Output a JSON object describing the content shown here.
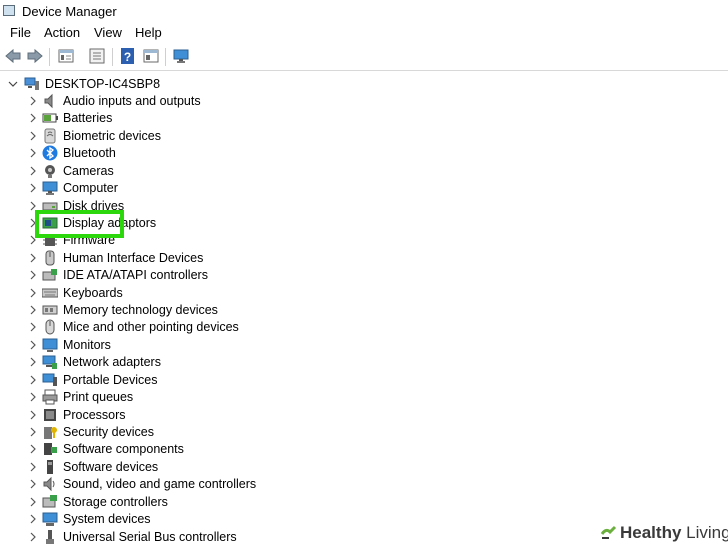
{
  "window": {
    "title": "Device Manager"
  },
  "menu": [
    "File",
    "Action",
    "View",
    "Help"
  ],
  "toolbar": [
    "back-icon",
    "forward-icon",
    "properties-icon",
    "list-icon",
    "help-icon",
    "view-icon",
    "scan-monitor-icon"
  ],
  "tree": {
    "root": "DESKTOP-IC4SBP8",
    "items": [
      {
        "label": "Audio inputs and outputs",
        "icon": "speaker-icon"
      },
      {
        "label": "Batteries",
        "icon": "battery-icon"
      },
      {
        "label": "Biometric devices",
        "icon": "biometric-icon"
      },
      {
        "label": "Bluetooth",
        "icon": "bluetooth-icon"
      },
      {
        "label": "Cameras",
        "icon": "camera-icon"
      },
      {
        "label": "Computer",
        "icon": "computer-icon"
      },
      {
        "label": "Disk drives",
        "icon": "disk-drive-icon"
      },
      {
        "label": "Display adaptors",
        "icon": "display-adapter-icon"
      },
      {
        "label": "Firmware",
        "icon": "firmware-icon"
      },
      {
        "label": "Human Interface Devices",
        "icon": "hid-icon"
      },
      {
        "label": "IDE ATA/ATAPI controllers",
        "icon": "ide-controller-icon"
      },
      {
        "label": "Keyboards",
        "icon": "keyboard-icon"
      },
      {
        "label": "Memory technology devices",
        "icon": "memory-icon"
      },
      {
        "label": "Mice and other pointing devices",
        "icon": "mouse-icon"
      },
      {
        "label": "Monitors",
        "icon": "monitor-icon"
      },
      {
        "label": "Network adapters",
        "icon": "network-adapter-icon"
      },
      {
        "label": "Portable Devices",
        "icon": "portable-device-icon"
      },
      {
        "label": "Print queues",
        "icon": "printer-icon"
      },
      {
        "label": "Processors",
        "icon": "processor-icon"
      },
      {
        "label": "Security devices",
        "icon": "security-device-icon"
      },
      {
        "label": "Software components",
        "icon": "software-component-icon"
      },
      {
        "label": "Software devices",
        "icon": "software-device-icon"
      },
      {
        "label": "Sound, video and game controllers",
        "icon": "sound-controller-icon"
      },
      {
        "label": "Storage controllers",
        "icon": "storage-controller-icon"
      },
      {
        "label": "System devices",
        "icon": "system-device-icon"
      },
      {
        "label": "Universal Serial Bus controllers",
        "icon": "usb-icon"
      }
    ]
  },
  "watermark": {
    "part1": "Healthy",
    "part2": " Living"
  },
  "colors": {
    "highlight": "#2cd80c",
    "bluetooth": "#1f7ae0"
  }
}
